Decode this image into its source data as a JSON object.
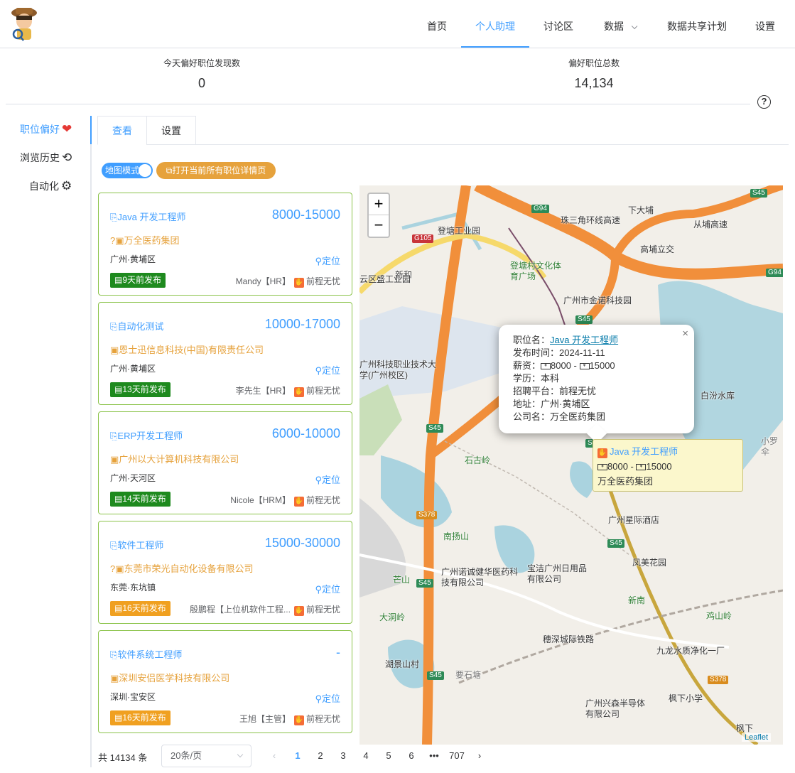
{
  "nav": {
    "items": [
      {
        "label": "首页"
      },
      {
        "label": "个人助理"
      },
      {
        "label": "讨论区"
      },
      {
        "label": "数据"
      },
      {
        "label": "数据共享计划"
      },
      {
        "label": "设置"
      }
    ]
  },
  "stats": {
    "today_label": "今天偏好职位发现数",
    "today_value": "0",
    "total_label": "偏好职位总数",
    "total_value": "14,134"
  },
  "help_icon": "?",
  "sidebar": {
    "items": [
      {
        "label": "职位偏好",
        "icon": "heart-icon",
        "glyph": "❤"
      },
      {
        "label": "浏览历史",
        "icon": "history-icon",
        "glyph": "⟲"
      },
      {
        "label": "自动化",
        "icon": "robot-icon",
        "glyph": "⚙"
      }
    ]
  },
  "tabs": [
    {
      "label": "查看"
    },
    {
      "label": "设置"
    }
  ],
  "toolbar": {
    "map_mode": "地图模式",
    "open_all": "打开当前所有职位详情页"
  },
  "jobs": [
    {
      "title": "Java 开发工程师",
      "salary": "8000-15000",
      "company": "万全医药集团",
      "company_prefix": "?",
      "location": "广州·黄埔区",
      "locate": "定位",
      "posted": "9天前发布",
      "posted_color": "#1e8a1e",
      "hr": "Mandy【HR】",
      "platform": "前程无忧"
    },
    {
      "title": "自动化测试",
      "salary": "10000-17000",
      "company": "恩士迅信息科技(中国)有限责任公司",
      "company_prefix": "",
      "location": "广州·黄埔区",
      "locate": "定位",
      "posted": "13天前发布",
      "posted_color": "#1e8a1e",
      "hr": "李先生【HR】",
      "platform": "前程无忧"
    },
    {
      "title": "ERP开发工程师",
      "salary": "6000-10000",
      "company": "广州以大计算机科技有限公司",
      "company_prefix": "",
      "location": "广州·天河区",
      "locate": "定位",
      "posted": "14天前发布",
      "posted_color": "#1e8a1e",
      "hr": "Nicole【HRM】",
      "platform": "前程无忧"
    },
    {
      "title": "软件工程师",
      "salary": "15000-30000",
      "company": "东莞市荣光自动化设备有限公司",
      "company_prefix": "?",
      "location": "东莞·东坑镇",
      "locate": "定位",
      "posted": "16天前发布",
      "posted_color": "#f0a020",
      "hr": "殷鹏程【上位机软件工程...",
      "platform": "前程无忧"
    },
    {
      "title": "软件系统工程师",
      "salary": "-",
      "company": "深圳安侣医学科技有限公司",
      "company_prefix": "",
      "location": "深圳·宝安区",
      "locate": "定位",
      "posted": "16天前发布",
      "posted_color": "#f0a020",
      "hr": "王旭【主管】",
      "platform": "前程无忧"
    }
  ],
  "map": {
    "zoom_in": "+",
    "zoom_out": "−",
    "popup": {
      "name_label": "职位名：",
      "name_value": "Java 开发工程师",
      "time_label": "发布时间：",
      "time_value": "2024-11-11",
      "salary_label": "薪资：",
      "salary_min": "8000",
      "salary_sep": " - ",
      "salary_max": "15000",
      "edu_label": "学历：",
      "edu_value": "本科",
      "platform_label": "招聘平台：",
      "platform_value": "前程无忧",
      "addr_label": "地址：",
      "addr_value": "广州·黄埔区",
      "company_label": "公司名：",
      "company_value": "万全医药集团",
      "close": "×"
    },
    "tooltip": {
      "title": "Java 开发工程师",
      "salary_min": "8000",
      "salary_max": "15000",
      "company": "万全医药集团"
    },
    "attribution": "Leaflet",
    "labels": [
      {
        "t": "登塘工业园"
      },
      {
        "t": "新和"
      },
      {
        "t": "登塘村文化体育广场"
      },
      {
        "t": "广州市金诺科技园"
      },
      {
        "t": "广州科技职业技术大学(广州校区)"
      },
      {
        "t": "珠三角环线高速"
      },
      {
        "t": "高埔立交"
      },
      {
        "t": "从埔高速"
      },
      {
        "t": "下大埔"
      },
      {
        "t": "白汾水库"
      },
      {
        "t": "石古岭"
      },
      {
        "t": "广州星际酒店"
      },
      {
        "t": "南扬山"
      },
      {
        "t": "凤美花园"
      },
      {
        "t": "广州诺诚健华医药科技有限公司"
      },
      {
        "t": "宝洁广州日用品有限公司"
      },
      {
        "t": "芒山"
      },
      {
        "t": "新南"
      },
      {
        "t": "大洞岭"
      },
      {
        "t": "鸡山岭"
      },
      {
        "t": "湖景山村"
      },
      {
        "t": "穗深城际铁路"
      },
      {
        "t": "九龙水质净化一厂"
      },
      {
        "t": "广州兴森半导体有限公司"
      },
      {
        "t": "枫下小学"
      },
      {
        "t": "枫下"
      },
      {
        "t": "从埔高速"
      },
      {
        "t": "云区盛工业园"
      },
      {
        "t": "小罗伞"
      },
      {
        "t": "要石塘"
      }
    ],
    "shields": [
      {
        "t": "G94"
      },
      {
        "t": "G105"
      },
      {
        "t": "S45"
      },
      {
        "t": "G94"
      },
      {
        "t": "S45"
      },
      {
        "t": "S45"
      },
      {
        "t": "S45"
      },
      {
        "t": "S378"
      },
      {
        "t": "S45"
      },
      {
        "t": "S45"
      },
      {
        "t": "S378"
      },
      {
        "t": "S45"
      }
    ]
  },
  "pagination": {
    "total": "共 14134 条",
    "page_size": "20条/页",
    "prev": "‹",
    "pages": [
      "1",
      "2",
      "3",
      "4",
      "5",
      "6",
      "•••",
      "707"
    ],
    "next": "›"
  }
}
